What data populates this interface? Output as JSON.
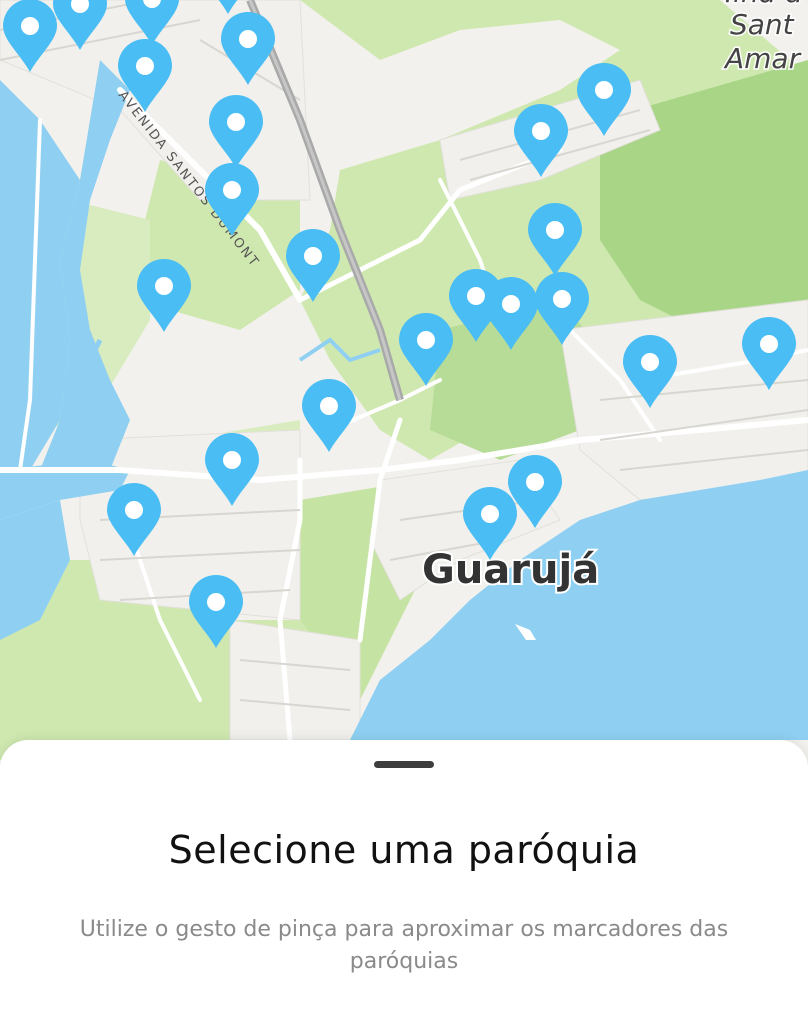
{
  "map": {
    "city_label": "Guarujá",
    "street_label": "AVENIDA SANTOS DUMONT",
    "island_label_lines": [
      "Ilha d",
      "Sant",
      "Amar"
    ],
    "marker_color": "#49bdf4",
    "water_color": "#8fd0f2",
    "park_color": "#c9e7a8",
    "marker_icon": "map-pin-icon",
    "marker_count": 28
  },
  "sheet": {
    "title": "Selecione uma paróquia",
    "subtitle": "Utilize o gesto de pinça para aproximar os marcadores das paróquias"
  }
}
